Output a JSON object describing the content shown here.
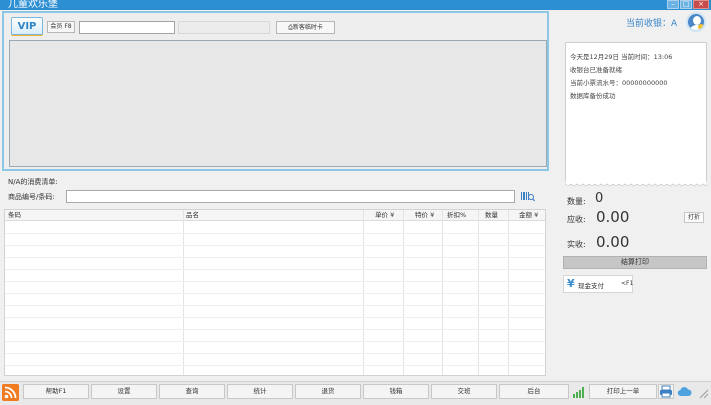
{
  "window": {
    "title": "儿童欢乐堡"
  },
  "member": {
    "vip_badge": "VIP",
    "member_button": "会员 F8",
    "card_button": "新客临时卡"
  },
  "list": {
    "title": "N/A的消费清单:",
    "code_label": "商品编号/条码:",
    "columns": [
      "条码",
      "品名",
      "单价 ¥",
      "特价 ¥",
      "折扣%",
      "数量",
      "金额 ¥"
    ]
  },
  "cashier": {
    "label": "当前收银：A"
  },
  "receipt": {
    "lines": [
      "今天是12月29日 当前时间：13:06",
      "收银台已准备就绪",
      "当前小票流水号：00000000000",
      "数据库备份成功"
    ]
  },
  "totals": {
    "qty_label": "数量:",
    "qty_value": "0",
    "due_label": "应收:",
    "due_value": "0.00",
    "discount_button": "打折",
    "paid_label": "实收:",
    "paid_value": "0.00",
    "settle_button": "结算打印",
    "pay_method": {
      "label": "现金支付",
      "key": "<F1"
    }
  },
  "toolbar": {
    "buttons": [
      "帮助F1",
      "设置",
      "查询",
      "统计",
      "退货",
      "钱箱",
      "交班",
      "后台"
    ],
    "reprint": "打印上一单"
  },
  "colors": {
    "title_bar": "#2d8fd3",
    "accent": "#3a86c8",
    "rss": "#f07b21"
  }
}
